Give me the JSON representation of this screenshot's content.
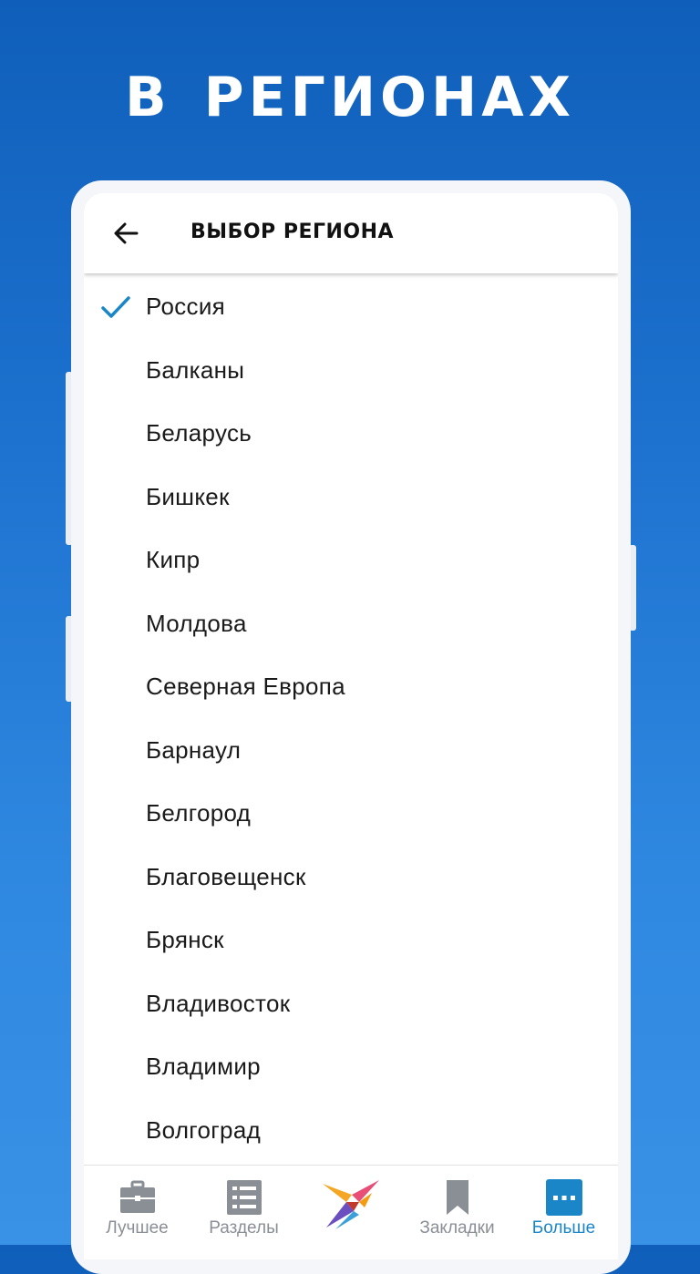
{
  "promo": {
    "title": "В  РЕГИОНАХ"
  },
  "app_bar": {
    "title": "ВЫБОР РЕГИОНА",
    "back_icon": "arrow-left-icon"
  },
  "regions": [
    {
      "label": "Россия",
      "selected": true
    },
    {
      "label": "Балканы",
      "selected": false
    },
    {
      "label": "Беларусь",
      "selected": false
    },
    {
      "label": "Бишкек",
      "selected": false
    },
    {
      "label": "Кипр",
      "selected": false
    },
    {
      "label": "Молдова",
      "selected": false
    },
    {
      "label": "Северная Европа",
      "selected": false
    },
    {
      "label": "Барнаул",
      "selected": false
    },
    {
      "label": "Белгород",
      "selected": false
    },
    {
      "label": "Благовещенск",
      "selected": false
    },
    {
      "label": "Брянск",
      "selected": false
    },
    {
      "label": "Владивосток",
      "selected": false
    },
    {
      "label": "Владимир",
      "selected": false
    },
    {
      "label": "Волгоград",
      "selected": false
    }
  ],
  "bottom_nav": [
    {
      "label": "Лучшее",
      "icon": "briefcase-icon",
      "active": false
    },
    {
      "label": "Разделы",
      "icon": "list-icon",
      "active": false
    },
    {
      "label": "",
      "icon": "swallow-logo-icon",
      "active": false
    },
    {
      "label": "Закладки",
      "icon": "bookmark-icon",
      "active": false
    },
    {
      "label": "Больше",
      "icon": "more-icon",
      "active": true
    }
  ],
  "colors": {
    "accent": "#1a86c8",
    "inactive": "#8a8f96",
    "background_top": "#0f5fba",
    "background_bottom": "#3a92e6"
  }
}
